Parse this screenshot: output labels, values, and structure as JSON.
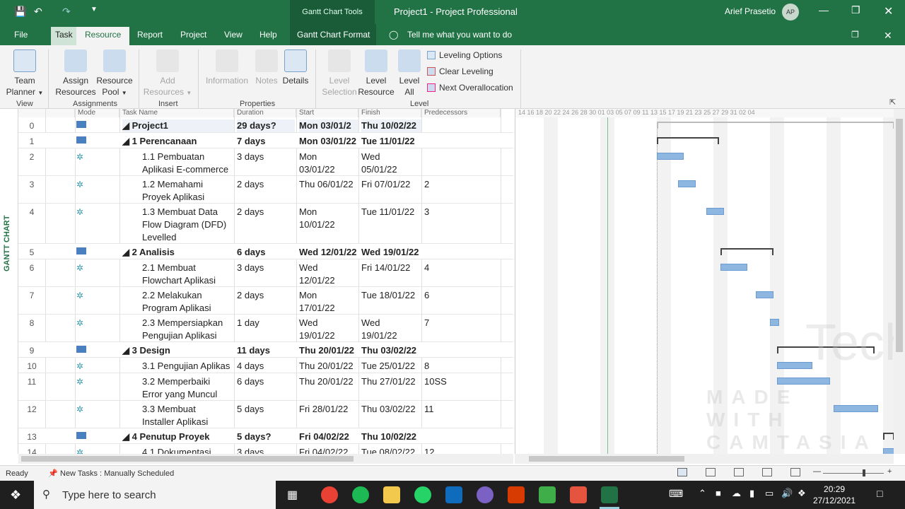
{
  "titlebar": {
    "context_tab": "Gantt Chart Tools",
    "title": "Project1  -  Project Professional",
    "user": "Arief Prasetio",
    "avatar": "AP"
  },
  "menu": {
    "file": "File",
    "task": "Task",
    "resource": "Resource",
    "report": "Report",
    "project": "Project",
    "view": "View",
    "help": "Help",
    "gantt_format": "Gantt Chart Format",
    "tell_me": "Tell me what you want to do"
  },
  "ribbon": {
    "team_planner": "Team",
    "team_planner2": "Planner",
    "assign": "Assign",
    "assign2": "Resources",
    "pool": "Resource",
    "pool2": "Pool",
    "add": "Add",
    "add2": "Resources",
    "information": "Information",
    "notes": "Notes",
    "details": "Details",
    "level_sel": "Level",
    "level_sel2": "Selection",
    "level_res": "Level",
    "level_res2": "Resource",
    "level_all": "Level",
    "level_all2": "All",
    "leveling_options": "Leveling Options",
    "clear_leveling": "Clear Leveling",
    "next_over": "Next Overallocation",
    "grp_view": "View",
    "grp_assign": "Assignments",
    "grp_insert": "Insert",
    "grp_props": "Properties",
    "grp_level": "Level"
  },
  "sidebar_label": "GANTT CHART",
  "columns": {
    "mode": "Mode",
    "task": "Task Name",
    "duration": "Duration",
    "start": "Start",
    "finish": "Finish",
    "pred": "Predecessors"
  },
  "timescale": "14  16  18  20  22  24  26  28  30  01  03  05  07  09  11  13  15  17  19  21  23  25  27  29  31  02  04",
  "rows": [
    {
      "n": "0",
      "name": "◢ Project1",
      "name2": "",
      "dur": "29 days?",
      "start": "Mon 03/01/2",
      "start2": "",
      "finish": "Thu 10/02/22",
      "finish2": "",
      "pred": "",
      "bold": true
    },
    {
      "n": "1",
      "name": "◢ 1 Perencanaan",
      "name2": "",
      "dur": "7 days",
      "start": "Mon 03/01/22",
      "start2": "",
      "finish": "Tue 11/01/22",
      "finish2": "",
      "pred": "",
      "bold": true
    },
    {
      "n": "2",
      "name": "1.1 Pembuatan",
      "name2": "Aplikasi E-commerce",
      "dur": "3 days",
      "start": "Mon",
      "start2": "03/01/22",
      "finish": "Wed",
      "finish2": "05/01/22",
      "pred": "",
      "bold": false
    },
    {
      "n": "3",
      "name": "1.2 Memahami",
      "name2": "Proyek Aplikasi",
      "dur": "2 days",
      "start": "Thu 06/01/22",
      "start2": "",
      "finish": "Fri 07/01/22",
      "finish2": "",
      "pred": "2",
      "bold": false
    },
    {
      "n": "4",
      "name": "1.3 Membuat Data",
      "name2": "Flow Diagram (DFD)",
      "name3": "Levelled",
      "dur": "2 days",
      "start": "Mon",
      "start2": "10/01/22",
      "finish": "Tue 11/01/22",
      "finish2": "",
      "pred": "3",
      "bold": false
    },
    {
      "n": "5",
      "name": "◢ 2 Analisis",
      "name2": "",
      "dur": "6 days",
      "start": "Wed 12/01/22",
      "start2": "",
      "finish": "Wed 19/01/22",
      "finish2": "",
      "pred": "",
      "bold": true
    },
    {
      "n": "6",
      "name": "2.1 Membuat",
      "name2": "Flowchart Aplikasi",
      "dur": "3 days",
      "start": "Wed",
      "start2": "12/01/22",
      "finish": "Fri 14/01/22",
      "finish2": "",
      "pred": "4",
      "bold": false
    },
    {
      "n": "7",
      "name": "2.2 Melakukan",
      "name2": "Program Aplikasi",
      "dur": "2 days",
      "start": "Mon",
      "start2": "17/01/22",
      "finish": "Tue 18/01/22",
      "finish2": "",
      "pred": "6",
      "bold": false
    },
    {
      "n": "8",
      "name": "2.3 Mempersiapkan",
      "name2": "Pengujian Aplikasi",
      "dur": "1 day",
      "start": "Wed",
      "start2": "19/01/22",
      "finish": "Wed",
      "finish2": "19/01/22",
      "pred": "7",
      "bold": false
    },
    {
      "n": "9",
      "name": "◢ 3 Design",
      "name2": "",
      "dur": "11 days",
      "start": "Thu 20/01/22",
      "start2": "",
      "finish": "Thu 03/02/22",
      "finish2": "",
      "pred": "",
      "bold": true
    },
    {
      "n": "10",
      "name": "3.1 Pengujian Aplikas",
      "name2": "",
      "dur": "4 days",
      "start": "Thu 20/01/22",
      "start2": "",
      "finish": "Tue 25/01/22",
      "finish2": "",
      "pred": "8",
      "bold": false
    },
    {
      "n": "11",
      "name": "3.2 Memperbaiki",
      "name2": "Error yang Muncul",
      "dur": "6 days",
      "start": "Thu 20/01/22",
      "start2": "",
      "finish": "Thu 27/01/22",
      "finish2": "",
      "pred": "10SS",
      "bold": false
    },
    {
      "n": "12",
      "name": "3.3 Membuat",
      "name2": "Installer Aplikasi",
      "dur": "5 days",
      "start": "Fri 28/01/22",
      "start2": "",
      "finish": "Thu 03/02/22",
      "finish2": "",
      "pred": "11",
      "bold": false
    },
    {
      "n": "13",
      "name": "◢ 4 Penutup Proyek",
      "name2": "",
      "dur": "5 days?",
      "start": "Fri 04/02/22",
      "start2": "",
      "finish": "Thu 10/02/22",
      "finish2": "",
      "pred": "",
      "bold": true
    },
    {
      "n": "14",
      "name": "4.1 Dokumentasi",
      "name2": "",
      "dur": "3 days",
      "start": "Fri 04/02/22",
      "start2": "",
      "finish": "Tue 08/02/22",
      "finish2": "",
      "pred": "12",
      "bold": false
    }
  ],
  "watermark": "TechSmith",
  "watermark2": "MADE WITH CAMTASIA FREE TRIAL",
  "status": {
    "ready": "Ready",
    "new_tasks": "New Tasks : Manually Scheduled"
  },
  "taskbar": {
    "search": "Type here to search",
    "time": "20:29",
    "date": "27/12/2021"
  },
  "colors": {
    "accent": "#217346",
    "bar": "#8db6e0"
  }
}
